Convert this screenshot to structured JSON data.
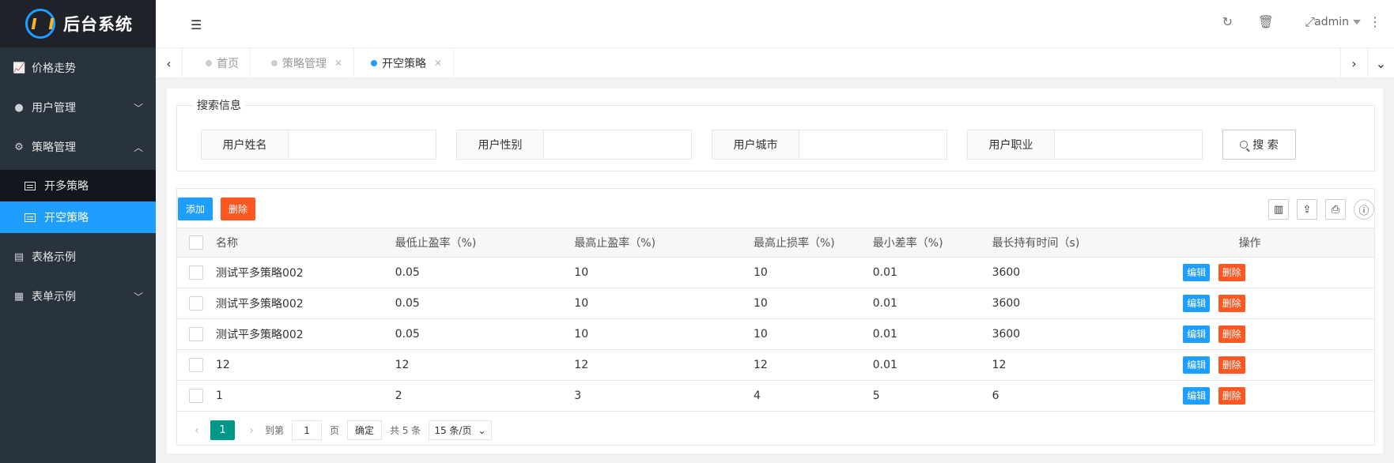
{
  "brand": {
    "title": "后台系统"
  },
  "sidebar": {
    "items": [
      {
        "label": "价格走势",
        "icon": "chart-icon"
      },
      {
        "label": "用户管理",
        "icon": "user-icon"
      },
      {
        "label": "策略管理",
        "icon": "gears-icon"
      },
      {
        "label": "开多策略",
        "icon": "list-icon"
      },
      {
        "label": "开空策略",
        "icon": "list-icon"
      },
      {
        "label": "表格示例",
        "icon": "file-icon"
      },
      {
        "label": "表单示例",
        "icon": "calendar-icon"
      }
    ]
  },
  "header": {
    "user": "admin"
  },
  "tabs": [
    {
      "label": "首页"
    },
    {
      "label": "策略管理"
    },
    {
      "label": "开空策略"
    }
  ],
  "search": {
    "legend": "搜索信息",
    "fields": [
      {
        "label": "用户姓名",
        "value": ""
      },
      {
        "label": "用户性别",
        "value": ""
      },
      {
        "label": "用户城市",
        "value": ""
      },
      {
        "label": "用户职业",
        "value": ""
      }
    ],
    "button_label": "搜 索"
  },
  "toolbar": {
    "add_label": "添加",
    "delete_label": "删除"
  },
  "table": {
    "columns": [
      "名称",
      "最低止盈率（%)",
      "最高止盈率（%)",
      "最高止损率（%)",
      "最小差率（%)",
      "最长持有时间（s)",
      "操作"
    ],
    "rows": [
      [
        "测试平多策略002",
        "0.05",
        "10",
        "10",
        "0.01",
        "3600"
      ],
      [
        "测试平多策略002",
        "0.05",
        "10",
        "10",
        "0.01",
        "3600"
      ],
      [
        "测试平多策略002",
        "0.05",
        "10",
        "10",
        "0.01",
        "3600"
      ],
      [
        "12",
        "12",
        "12",
        "12",
        "0.01",
        "12"
      ],
      [
        "1",
        "2",
        "3",
        "4",
        "5",
        "6"
      ]
    ],
    "edit_label": "编辑",
    "row_delete_label": "删除"
  },
  "pager": {
    "current": "1",
    "goto_label": "到第",
    "goto_value": "1",
    "page_unit": "页",
    "confirm": "确定",
    "total": "共 5 条",
    "page_size": "15 条/页"
  },
  "colors": {
    "primary": "#1e9fff",
    "danger": "#ff5722",
    "pager": "#009688",
    "sidebar": "#28333e"
  }
}
